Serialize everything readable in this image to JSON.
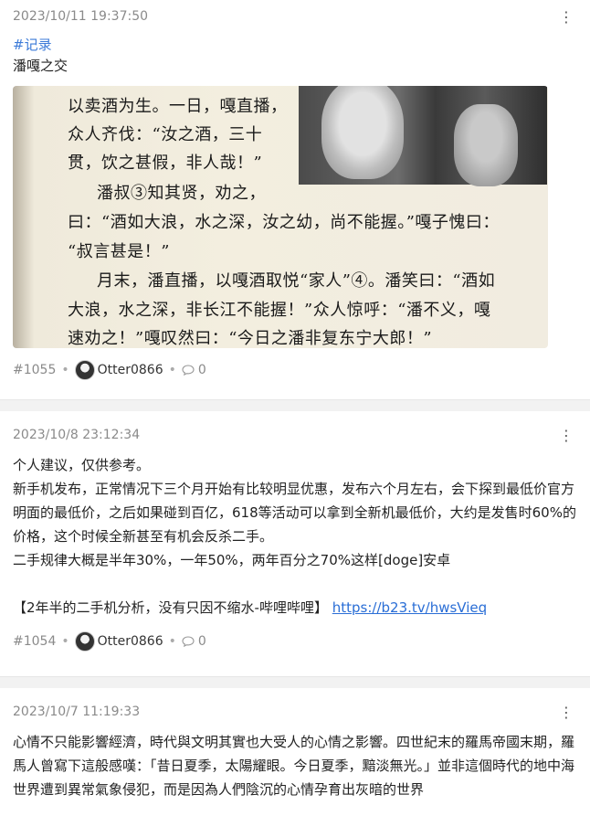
{
  "posts": [
    {
      "date": "2023/10/11 19:37:50",
      "tag": "#记录",
      "title": "潘嘎之交",
      "image_lines": [
        "以卖酒为生。一日，嘎直播，",
        "众人齐伐：“汝之酒，三十",
        "贯，饮之甚假，非人哉！”",
        "潘叔③知其贤，劝之，",
        "曰：“酒如大浪，水之深，汝之幼，尚不能握。”嘎子愧曰：",
        "“叔言甚是！”",
        "月末，潘直播，以嘎酒取悦“家人”④。潘笑曰：“酒如",
        "大浪，水之深，非长江不能握！”众人惊呼：“潘不义，嘎",
        "速劝之！”嘎叹然曰：“今日之潘非复东宁大郎！”"
      ],
      "id": "#1055",
      "author": "Otter0866",
      "comments": "0"
    },
    {
      "date": "2023/10/8 23:12:34",
      "paragraphs": [
        "个人建议，仅供参考。",
        "新手机发布，正常情况下三个月开始有比较明显优惠，发布六个月左右，会下探到最低价官方明面的最低价，之后如果碰到百亿，618等活动可以拿到全新机最低价，大约是发售时60%的价格，这个时候全新甚至有机会反杀二手。",
        "二手规律大概是半年30%，一年50%，两年百分之70%这样[doge]安卓"
      ],
      "link_prefix": "【2年半的二手机分析，没有只因不缩水-哔哩哔哩】",
      "link_url": "https://b23.tv/hwsVieq",
      "id": "#1054",
      "author": "Otter0866",
      "comments": "0"
    },
    {
      "date": "2023/10/7 11:19:33",
      "text": "心情不只能影響經濟，時代與文明其實也大受人的心情之影響。四世紀末的羅馬帝國末期，羅馬人曾寫下這般感嘆：「昔日夏季，太陽耀眼。今日夏季，黯淡無光。」並非這個時代的地中海世界遭到異常氣象侵犯，而是因為人們陰沉的心情孕育出灰暗的世界"
    }
  ],
  "colors": {
    "tag": "#3d7bd8",
    "link": "#2a6ed6",
    "muted": "#8a8a8a"
  },
  "icons": {
    "menu": "more-vertical-icon",
    "comment": "comment-icon",
    "avatar": "otter-avatar"
  }
}
